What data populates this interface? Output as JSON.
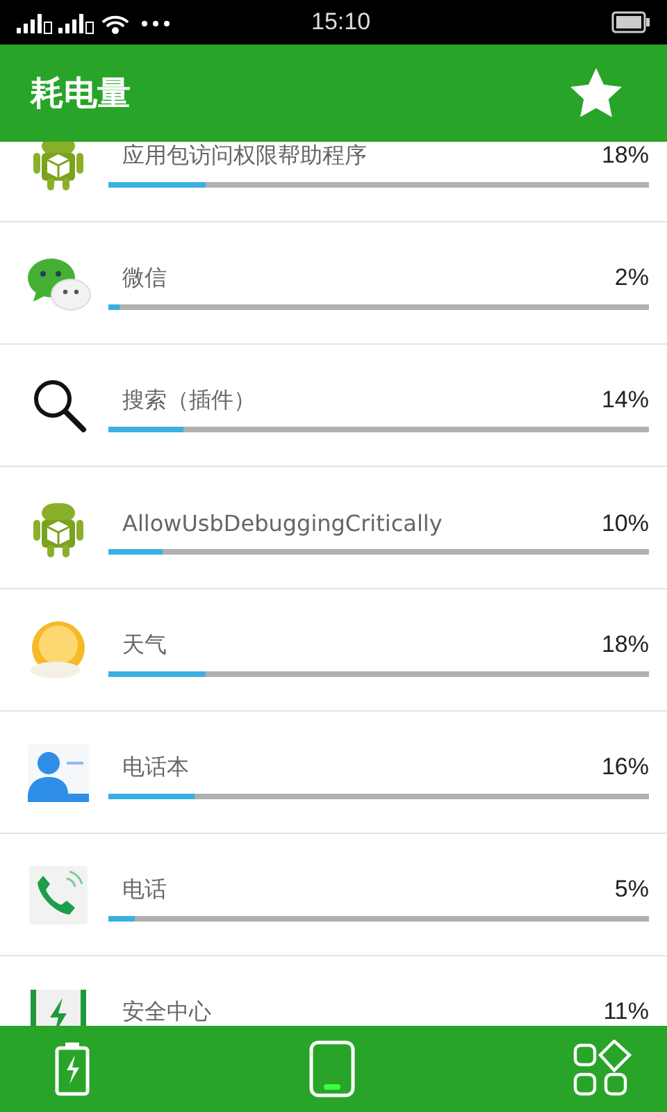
{
  "status_bar": {
    "time": "15:10"
  },
  "header": {
    "title": "耗电量"
  },
  "apps": [
    {
      "kind": "android",
      "name": "应用包访问权限帮助程序",
      "percent": "18%",
      "level": 0.18
    },
    {
      "kind": "wechat",
      "name": "微信",
      "percent": "2%",
      "level": 0.02
    },
    {
      "kind": "search",
      "name": "搜索（插件）",
      "percent": "14%",
      "level": 0.14
    },
    {
      "kind": "android",
      "name": "AllowUsbDebuggingCritically",
      "percent": "10%",
      "level": 0.1
    },
    {
      "kind": "weather",
      "name": "天气",
      "percent": "18%",
      "level": 0.18
    },
    {
      "kind": "contacts",
      "name": "电话本",
      "percent": "16%",
      "level": 0.16
    },
    {
      "kind": "phone",
      "name": "电话",
      "percent": "5%",
      "level": 0.05
    },
    {
      "kind": "security",
      "name": "安全中心",
      "percent": "11%"
    }
  ],
  "bottom_tabs": [
    {
      "kind": "battery",
      "selected": false
    },
    {
      "kind": "device",
      "selected": true
    },
    {
      "kind": "apps",
      "selected": false
    }
  ]
}
